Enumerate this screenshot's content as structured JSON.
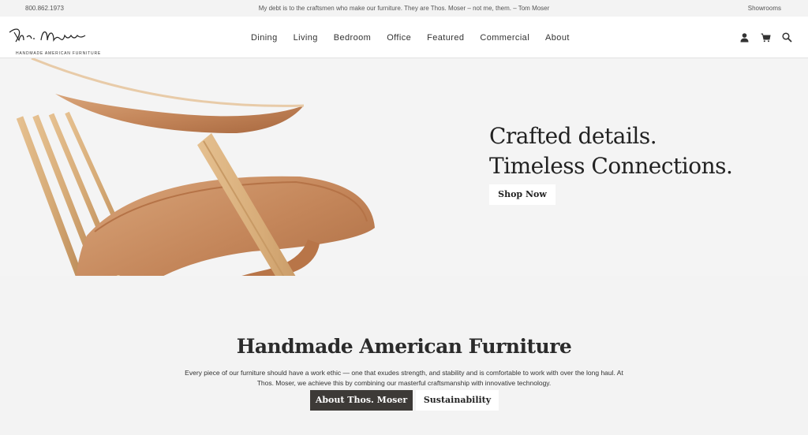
{
  "topbar": {
    "phone": "800.862.1973",
    "quote": "My debt is to the craftsmen who make our furniture. They are Thos. Moser – not me, them. – Tom Moser",
    "showrooms": "Showrooms"
  },
  "brand": {
    "script": "Thos. Moser",
    "subtitle": "HANDMADE AMERICAN FURNITURE"
  },
  "nav": {
    "items": [
      "Dining",
      "Living",
      "Bedroom",
      "Office",
      "Featured",
      "Commercial",
      "About"
    ]
  },
  "header_icons": [
    "account-icon",
    "cart-icon",
    "search-icon"
  ],
  "hero": {
    "line1": "Crafted details.",
    "line2": "Timeless Connections.",
    "cta": "Shop Now"
  },
  "intro": {
    "title": "Handmade American Furniture",
    "body": "Every piece of our furniture should have a work ethic — one that exudes strength, and stability and is comfortable to work with over the long haul. At Thos. Moser, we achieve this by combining our masterful craftsmanship with innovative technology.",
    "primary_button": "About Thos. Moser",
    "secondary_button": "Sustainability"
  },
  "colors": {
    "background": "#f3f3f3",
    "dark_button": "#3d3a37",
    "wood": "#c98b5b"
  }
}
